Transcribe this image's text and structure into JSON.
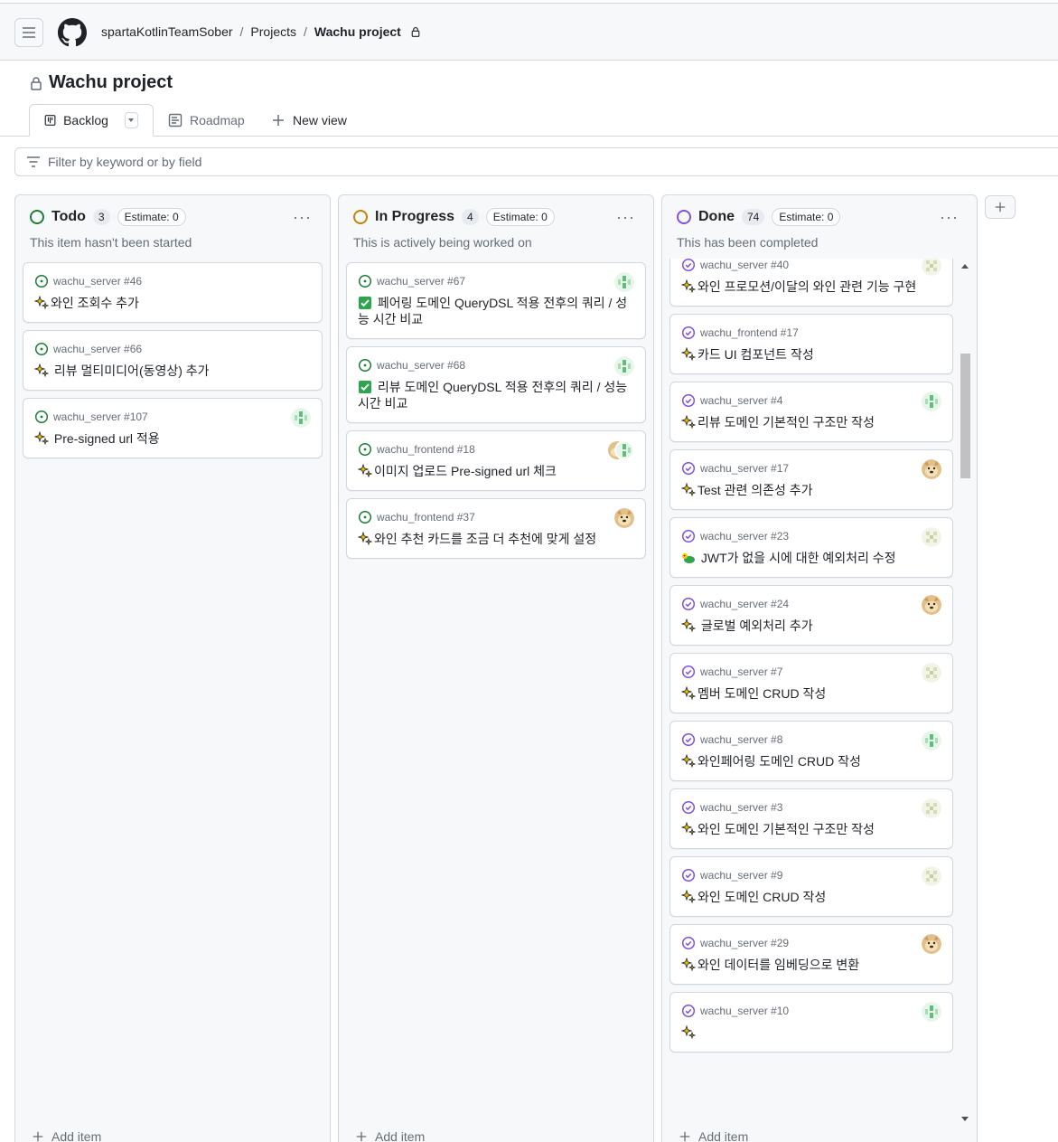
{
  "header": {
    "org": "spartaKotlinTeamSober",
    "projects": "Projects",
    "current": "Wachu project"
  },
  "project": {
    "title": "Wachu project"
  },
  "tabs": [
    {
      "label": "Backlog",
      "icon": "board-icon"
    },
    {
      "label": "Roadmap",
      "icon": "roadmap-icon"
    },
    {
      "label": "New view",
      "icon": "plus-icon"
    }
  ],
  "filter": {
    "placeholder": "Filter by keyword or by field"
  },
  "columns": {
    "todo": {
      "name": "Todo",
      "count": "3",
      "estimate": "Estimate: 0",
      "desc": "This item hasn't been started",
      "color": "#1a7f37",
      "add": "Add item",
      "cards": [
        {
          "meta": "wachu_server #46",
          "title": "와인 조회수 추가",
          "avatar": ""
        },
        {
          "meta": "wachu_server #66",
          "title": " 리뷰 멀티미디어(동영상) 추가",
          "avatar": ""
        },
        {
          "meta": "wachu_server #107",
          "title": " Pre-signed url 적용",
          "avatar": "green"
        }
      ]
    },
    "progress": {
      "name": "In Progress",
      "count": "4",
      "estimate": "Estimate: 0",
      "desc": "This is actively being worked on",
      "color": "#bf8700",
      "add": "Add item",
      "cards": [
        {
          "meta": "wachu_server #67",
          "title": " 페어링 도메인 QueryDSL 적용 전후의 쿼리 / 성능 시간 비교",
          "avatar": "green",
          "emoji": "check"
        },
        {
          "meta": "wachu_server #68",
          "title": " 리뷰 도메인 QueryDSL 적용 전후의 쿼리 / 성능 시간 비교",
          "avatar": "green",
          "emoji": "check"
        },
        {
          "meta": "wachu_frontend #18",
          "title": "이미지 업로드 Pre-signed url 체크",
          "avatar": "double"
        },
        {
          "meta": "wachu_frontend #37",
          "title": "와인 추천 카드를 조금 더 추천에 맞게 설정",
          "avatar": "doge"
        }
      ]
    },
    "done": {
      "name": "Done",
      "count": "74",
      "estimate": "Estimate: 0",
      "desc": "This has been completed",
      "color": "#8250df",
      "add": "Add item",
      "cards": [
        {
          "meta": "wachu_server #40",
          "title": "와인 프로모션/이달의 와인 관련 기능 구현",
          "avatar": "pale"
        },
        {
          "meta": "wachu_frontend #17",
          "title": "카드 UI 컴포넌트 작성",
          "avatar": ""
        },
        {
          "meta": "wachu_server #4",
          "title": "리뷰 도메인 기본적인 구조만 작성",
          "avatar": "green"
        },
        {
          "meta": "wachu_server #17",
          "title": "Test 관련 의존성 추가",
          "avatar": "doge"
        },
        {
          "meta": "wachu_server #23",
          "title": " JWT가 없을 시에 대한 예외처리 수정",
          "avatar": "pale",
          "emoji": "bug"
        },
        {
          "meta": "wachu_server #24",
          "title": " 글로벌 예외처리 추가",
          "avatar": "doge"
        },
        {
          "meta": "wachu_server #7",
          "title": "멤버 도메인 CRUD 작성",
          "avatar": "pale"
        },
        {
          "meta": "wachu_server #8",
          "title": "와인페어링 도메인 CRUD 작성",
          "avatar": "green"
        },
        {
          "meta": "wachu_server #3",
          "title": "와인 도메인 기본적인 구조만 작성",
          "avatar": "pale"
        },
        {
          "meta": "wachu_server #9",
          "title": "와인 도메인 CRUD 작성",
          "avatar": "pale"
        },
        {
          "meta": "wachu_server #29",
          "title": "와인 데이터를 임베딩으로 변환",
          "avatar": "doge"
        },
        {
          "meta": "wachu_server #10",
          "title": "",
          "avatar": "green"
        }
      ]
    }
  },
  "icons": {
    "menu": "hamburger-icon",
    "logo": "github-logo-icon",
    "lock": "lock-icon",
    "filter": "filter-icon",
    "more": "kebab-icon",
    "add": "plus-icon",
    "open": "issue-open-icon",
    "closed": "issue-closed-icon",
    "sparkle": "sparkles-icon"
  }
}
